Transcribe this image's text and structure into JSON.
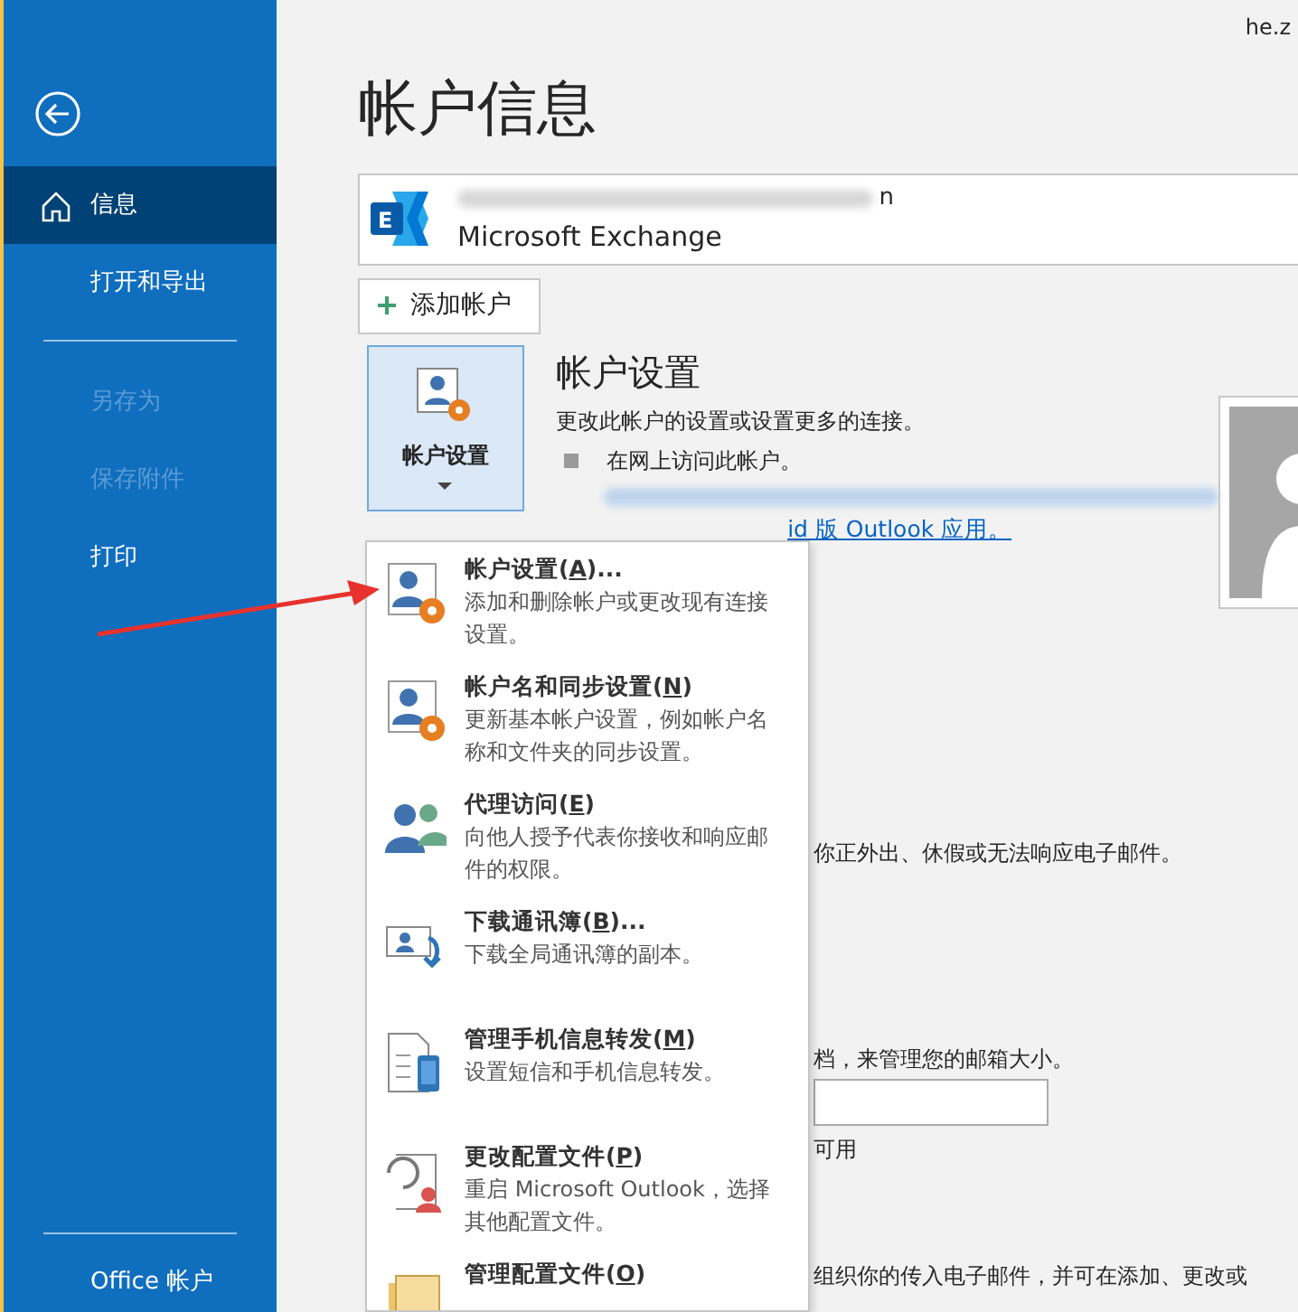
{
  "window": {
    "user": "he.z"
  },
  "sidebar": {
    "items": [
      {
        "kind": "home",
        "label": "信息",
        "selected": true,
        "disabled": false
      },
      {
        "kind": "plain",
        "label": "打开和导出",
        "selected": false,
        "disabled": false
      },
      {
        "kind": "divider"
      },
      {
        "kind": "plain",
        "label": "另存为",
        "selected": false,
        "disabled": true
      },
      {
        "kind": "plain",
        "label": "保存附件",
        "selected": false,
        "disabled": true
      },
      {
        "kind": "plain",
        "label": "打印",
        "selected": false,
        "disabled": false
      }
    ],
    "footer": "Office 帐户"
  },
  "page_title": "帐户信息",
  "account": {
    "icon_letter": "E",
    "address_tail": "n",
    "type": "Microsoft Exchange"
  },
  "add_account_button": "添加帐户",
  "account_settings": {
    "button_label": "帐户设置",
    "heading": "帐户设置",
    "description": "更改此帐户的设置或设置更多的连接。",
    "bullet": "在网上访问此帐户。",
    "link": "id 版 Outlook 应用。"
  },
  "background_texts": [
    {
      "kind": "text",
      "text": "你正外出、休假或无法响应电子邮件。"
    },
    {
      "kind": "text",
      "text": "档，来管理您的邮箱大小。"
    },
    {
      "kind": "field"
    },
    {
      "kind": "text",
      "text": "可用"
    },
    {
      "kind": "text",
      "text": "组织你的传入电子邮件，并可在添加、更改或"
    }
  ],
  "menu": [
    {
      "kind": "settings",
      "title_before": "帐户设置(",
      "access_key": "A",
      "title_after": ")...",
      "description": "添加和删除帐户或更改现有连接设置。"
    },
    {
      "kind": "settings",
      "title_before": "帐户名和同步设置(",
      "access_key": "N",
      "title_after": ")",
      "description": "更新基本帐户设置，例如帐户名称和文件夹的同步设置。"
    },
    {
      "kind": "people",
      "title_before": "代理访问(",
      "access_key": "E",
      "title_after": ")",
      "description": "向他人授予代表你接收和响应邮件的权限。"
    },
    {
      "kind": "download",
      "title_before": "下载通讯簿(",
      "access_key": "B",
      "title_after": ")...",
      "description": "下载全局通讯簿的副本。"
    },
    {
      "kind": "phone",
      "title_before": "管理手机信息转发(",
      "access_key": "M",
      "title_after": ")",
      "description": "设置短信和手机信息转发。"
    },
    {
      "kind": "profile",
      "title_before": "更改配置文件(",
      "access_key": "P",
      "title_after": ")",
      "description": "重启 Microsoft Outlook，选择其他配置文件。"
    },
    {
      "kind": "folders",
      "title_before": "管理配置文件(",
      "access_key": "O",
      "title_after": ")"
    }
  ]
}
